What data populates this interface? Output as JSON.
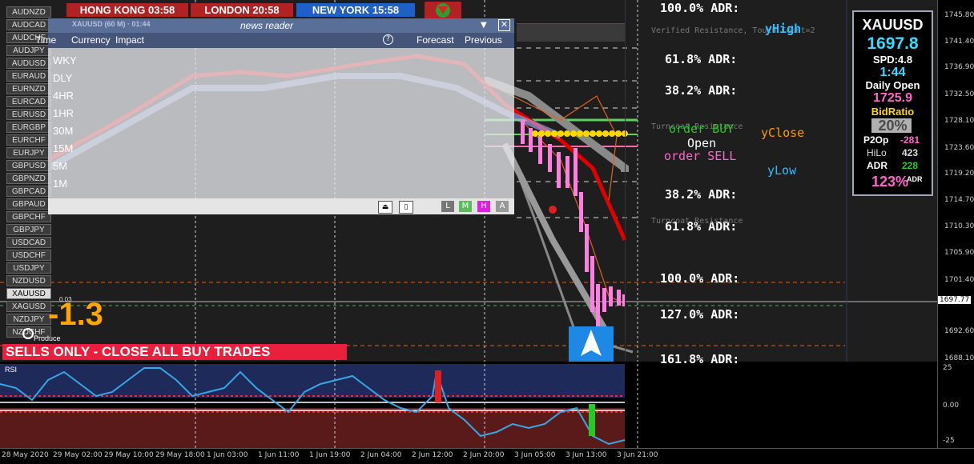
{
  "symbol_list": [
    "AUDNZD",
    "AUDCAD",
    "AUDCHF",
    "AUDJPY",
    "AUDUSD",
    "EURAUD",
    "EURNZD",
    "EURCAD",
    "EURUSD",
    "EURGBP",
    "EURCHF",
    "EURJPY",
    "GBPUSD",
    "GBPNZD",
    "GBPCAD",
    "GBPAUD",
    "GBPCHF",
    "GBPJPY",
    "USDCAD",
    "USDCHF",
    "USDJPY",
    "NZDUSD",
    "XAUUSD",
    "XAGUSD",
    "NZDJPY",
    "NZDCHF"
  ],
  "active_symbol": "XAUUSD",
  "clocks": [
    {
      "city": "HONG KONG",
      "time": "03:58",
      "color": "#b22222"
    },
    {
      "city": "LONDON",
      "time": "20:58",
      "color": "#b22222"
    },
    {
      "city": "NEW YORK",
      "time": "15:58",
      "color": "#1e5fc8"
    }
  ],
  "news_reader": {
    "title": "news reader",
    "subtitle": "XAUUSD (60 M) · 01:44",
    "columns": [
      "Time",
      "Currency",
      "Impact"
    ],
    "right_columns": [
      "Forecast",
      "Previous"
    ],
    "help": "?",
    "timeframes": [
      "WKY",
      "DLY",
      "4HR",
      "1HR",
      "30M",
      "15M",
      "5M",
      "1M"
    ],
    "footer_buttons": [
      "L",
      "M",
      "H",
      "A"
    ]
  },
  "adr_levels_top": [
    "100.0% ADR:",
    "61.8% ADR:",
    "38.2% ADR:"
  ],
  "adr_levels_bottom": [
    "38.2% ADR:",
    "61.8% ADR:",
    "100.0% ADR:",
    "127.0% ADR:",
    "161.8% ADR:"
  ],
  "chart_labels": {
    "yhigh": "yHigh",
    "yclose": "yClose",
    "ylow": "yLow",
    "order_buy": "order BUY",
    "open": "Open",
    "order_sell": "order SELL",
    "verified_resistance": "Verified Resistance, Touch Count=2",
    "turncoat_resistance": "Turncoat Resistance",
    "forecast_resistance": "Turncoat Resistance"
  },
  "signal": {
    "value": "-1.3",
    "produce": "Produce",
    "banner": "SELLS ONLY - CLOSE ALL BUY TRADES",
    "small_value": "0.03"
  },
  "info_panel": {
    "symbol": "XAUUSD",
    "price": "1697.8",
    "spread": "SPD:4.8",
    "timer": "1:44",
    "daily_open_label": "Daily Open",
    "daily_open": "1725.9",
    "bidratio_label": "BidRatio",
    "bidratio": "20%",
    "p2op_label": "P2Op",
    "p2op": "-281",
    "hilo_label": "HiLo",
    "hilo": "423",
    "adr_label": "ADR",
    "adr": "228",
    "adr_pct": "123%",
    "adr_small": "ADR"
  },
  "price_axis": [
    "1745.80",
    "1741.40",
    "1736.90",
    "1732.50",
    "1728.10",
    "1723.60",
    "1719.20",
    "1714.70",
    "1710.30",
    "1705.90",
    "1701.40",
    "1697.77",
    "1692.60",
    "1688.10"
  ],
  "current_price": "1697.77",
  "rsi": {
    "label": "RSI",
    "ticks": [
      "25",
      "0.00",
      "-25"
    ]
  },
  "time_axis": [
    "28 May 2020",
    "29 May 02:00",
    "29 May 10:00",
    "29 May 18:00",
    "1 Jun 03:00",
    "1 Jun 11:00",
    "1 Jun 19:00",
    "2 Jun 04:00",
    "2 Jun 12:00",
    "2 Jun 20:00",
    "3 Jun 05:00",
    "3 Jun 13:00",
    "3 Jun 21:00"
  ],
  "colors": {
    "buy": "#22cc22",
    "sell": "#ff66cc",
    "yclose": "#ff9900",
    "ylevel": "#33bbff",
    "banner": "#e8203c",
    "rsi_line": "#35a8e8"
  }
}
